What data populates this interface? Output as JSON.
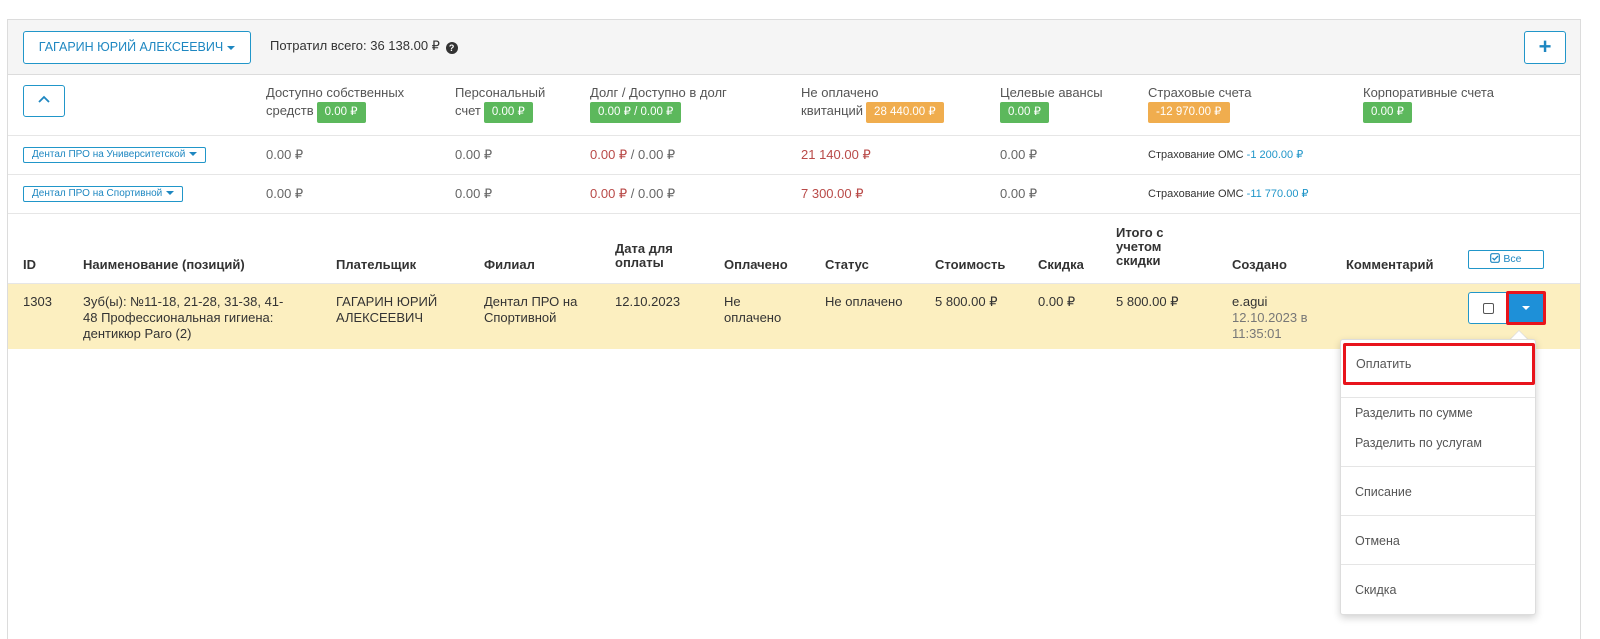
{
  "header": {
    "patient_name": "ГАГАРИН ЮРИЙ АЛЕКСЕЕВИЧ",
    "spent_label": "Потратил всего: 36 138.00 ₽",
    "add_label": "+"
  },
  "summary": {
    "own_funds_l1": "Доступно собственных",
    "own_funds_l2": "средств",
    "own_funds_value": "0.00 ₽",
    "personal_l1": "Персональный",
    "personal_l2": "счет",
    "personal_value": "0.00 ₽",
    "debt_label": "Долг / Доступно в долг",
    "debt_value": "0.00 ₽ / 0.00 ₽",
    "unpaid_l1": "Не оплачено",
    "unpaid_l2": "квитанций",
    "unpaid_value": "28 440.00 ₽",
    "target_label": "Целевые авансы",
    "target_value": "0.00 ₽",
    "insurance_label": "Страховые счета",
    "insurance_value": "-12 970.00 ₽",
    "corporate_label": "Корпоративные счета",
    "corporate_value": "0.00 ₽"
  },
  "branches": [
    {
      "name": "Дентал ПРО на Университетской",
      "own": "0.00 ₽",
      "personal": "0.00 ₽",
      "debt_a": "0.00 ₽",
      "debt_b": " / 0.00 ₽",
      "unpaid": "21 140.00 ₽",
      "target": "0.00 ₽",
      "insurance_label": "Страхование ОМС",
      "insurance_value": "-1 200.00 ₽"
    },
    {
      "name": "Дентал ПРО на Спортивной",
      "own": "0.00 ₽",
      "personal": "0.00 ₽",
      "debt_a": "0.00 ₽",
      "debt_b": " / 0.00 ₽",
      "unpaid": "7 300.00 ₽",
      "target": "0.00 ₽",
      "insurance_label": "Страхование ОМС",
      "insurance_value": "-11 770.00 ₽"
    }
  ],
  "table": {
    "headers": {
      "id": "ID",
      "name": "Наименование (позиций)",
      "payer": "Плательщик",
      "branch": "Филиал",
      "due_l1": "Дата для",
      "due_l2": "оплаты",
      "paid": "Оплачено",
      "status": "Статус",
      "cost": "Стоимость",
      "discount": "Скидка",
      "total_l1": "Итого с",
      "total_l2": "учетом",
      "total_l3": "скидки",
      "created": "Создано",
      "comment": "Комментарий",
      "all_button": "Все"
    },
    "row": {
      "id": "1303",
      "name_l1": "Зуб(ы): №11-18, 21-28, 31-38, 41-",
      "name_l2": "48 Профессиональная гигиена:",
      "name_l3": "дентикюр Paro (2)",
      "payer_l1": "ГАГАРИН ЮРИЙ",
      "payer_l2": "АЛЕКСЕЕВИЧ",
      "branch_l1": "Дентал ПРО на",
      "branch_l2": "Спортивной",
      "due": "12.10.2023",
      "paid_l1": "Не",
      "paid_l2": "оплачено",
      "status": "Не оплачено",
      "cost": "5 800.00 ₽",
      "discount": "0.00 ₽",
      "total": "5 800.00 ₽",
      "created_by": "e.agui",
      "created_date": "12.10.2023 в",
      "created_time": "11:35:01"
    }
  },
  "menu": {
    "items": [
      "Оплатить",
      "Разделить по сумме",
      "Разделить по услугам",
      "Списание",
      "Отмена",
      "Скидка"
    ]
  },
  "colors": {
    "accent": "#1e90d8",
    "green_badge": "#5cb85c",
    "orange_badge": "#f0ad4e",
    "row_highlight": "#fcefc0",
    "highlight_border": "#e8141c"
  }
}
